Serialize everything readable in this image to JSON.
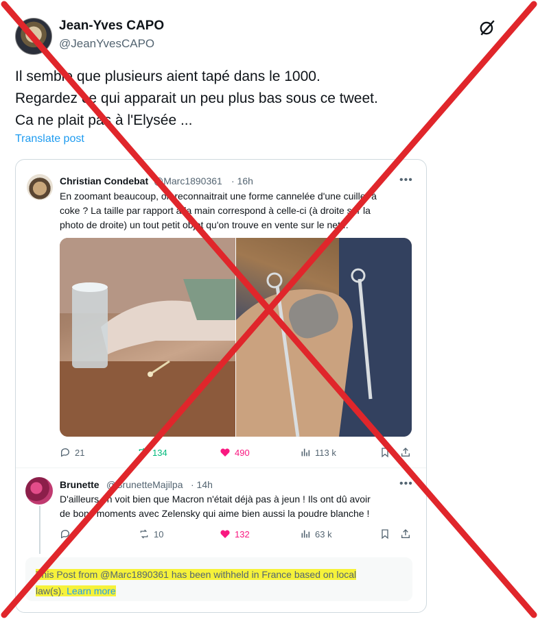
{
  "main_post": {
    "author_name": "Jean-Yves CAPO",
    "author_handle": "@JeanYvesCAPO",
    "text_lines": [
      "Il semble que plusieurs aient tapé dans le 1000.",
      "Regardez ce qui apparait un peu plus bas sous ce tweet.",
      "Ca ne plait pas à l'Elysée ..."
    ],
    "translate_label": "Translate post",
    "grok_icon": "grok-icon"
  },
  "quoted_post": {
    "author_name": "Christian Condebat",
    "author_handle": "@Marc1890361",
    "time": "· 16h",
    "more_label": "•••",
    "text_lines": [
      "En zoomant beaucoup, on reconnaitrait une forme cannelée d'une cuiller à",
      "coke ? La taille par rapport à la main correspond à celle-ci (à droite sur la",
      "photo de droite) un tout petit objet qu'on trouve en vente sur le net..."
    ],
    "actions": {
      "replies": "21",
      "reposts": "134",
      "likes": "490",
      "views": "113 k"
    }
  },
  "reply_post": {
    "author_name": "Brunette",
    "author_handle": "@BrunetteMajilpa",
    "time": "· 14h",
    "more_label": "•••",
    "text_lines": [
      "D'ailleurs on voit bien que Macron n'était déjà pas à jeun ! Ils ont dû avoir",
      "de bons moments avec Zelensky qui aime bien aussi la poudre blanche !"
    ],
    "actions": {
      "reposts": "10",
      "likes": "132",
      "views": "63 k"
    }
  },
  "withheld_notice": {
    "line1": "This Post from @Marc1890361 has been withheld in France based on local",
    "line2_prefix": "law(s).",
    "learn_more": "Learn more"
  },
  "colors": {
    "accent_blue": "#1d9bf0",
    "like_pink": "#f91880",
    "repost_green": "#00ba7c",
    "highlight_yellow": "#f6f23a",
    "overlay_red": "#e0262b"
  }
}
